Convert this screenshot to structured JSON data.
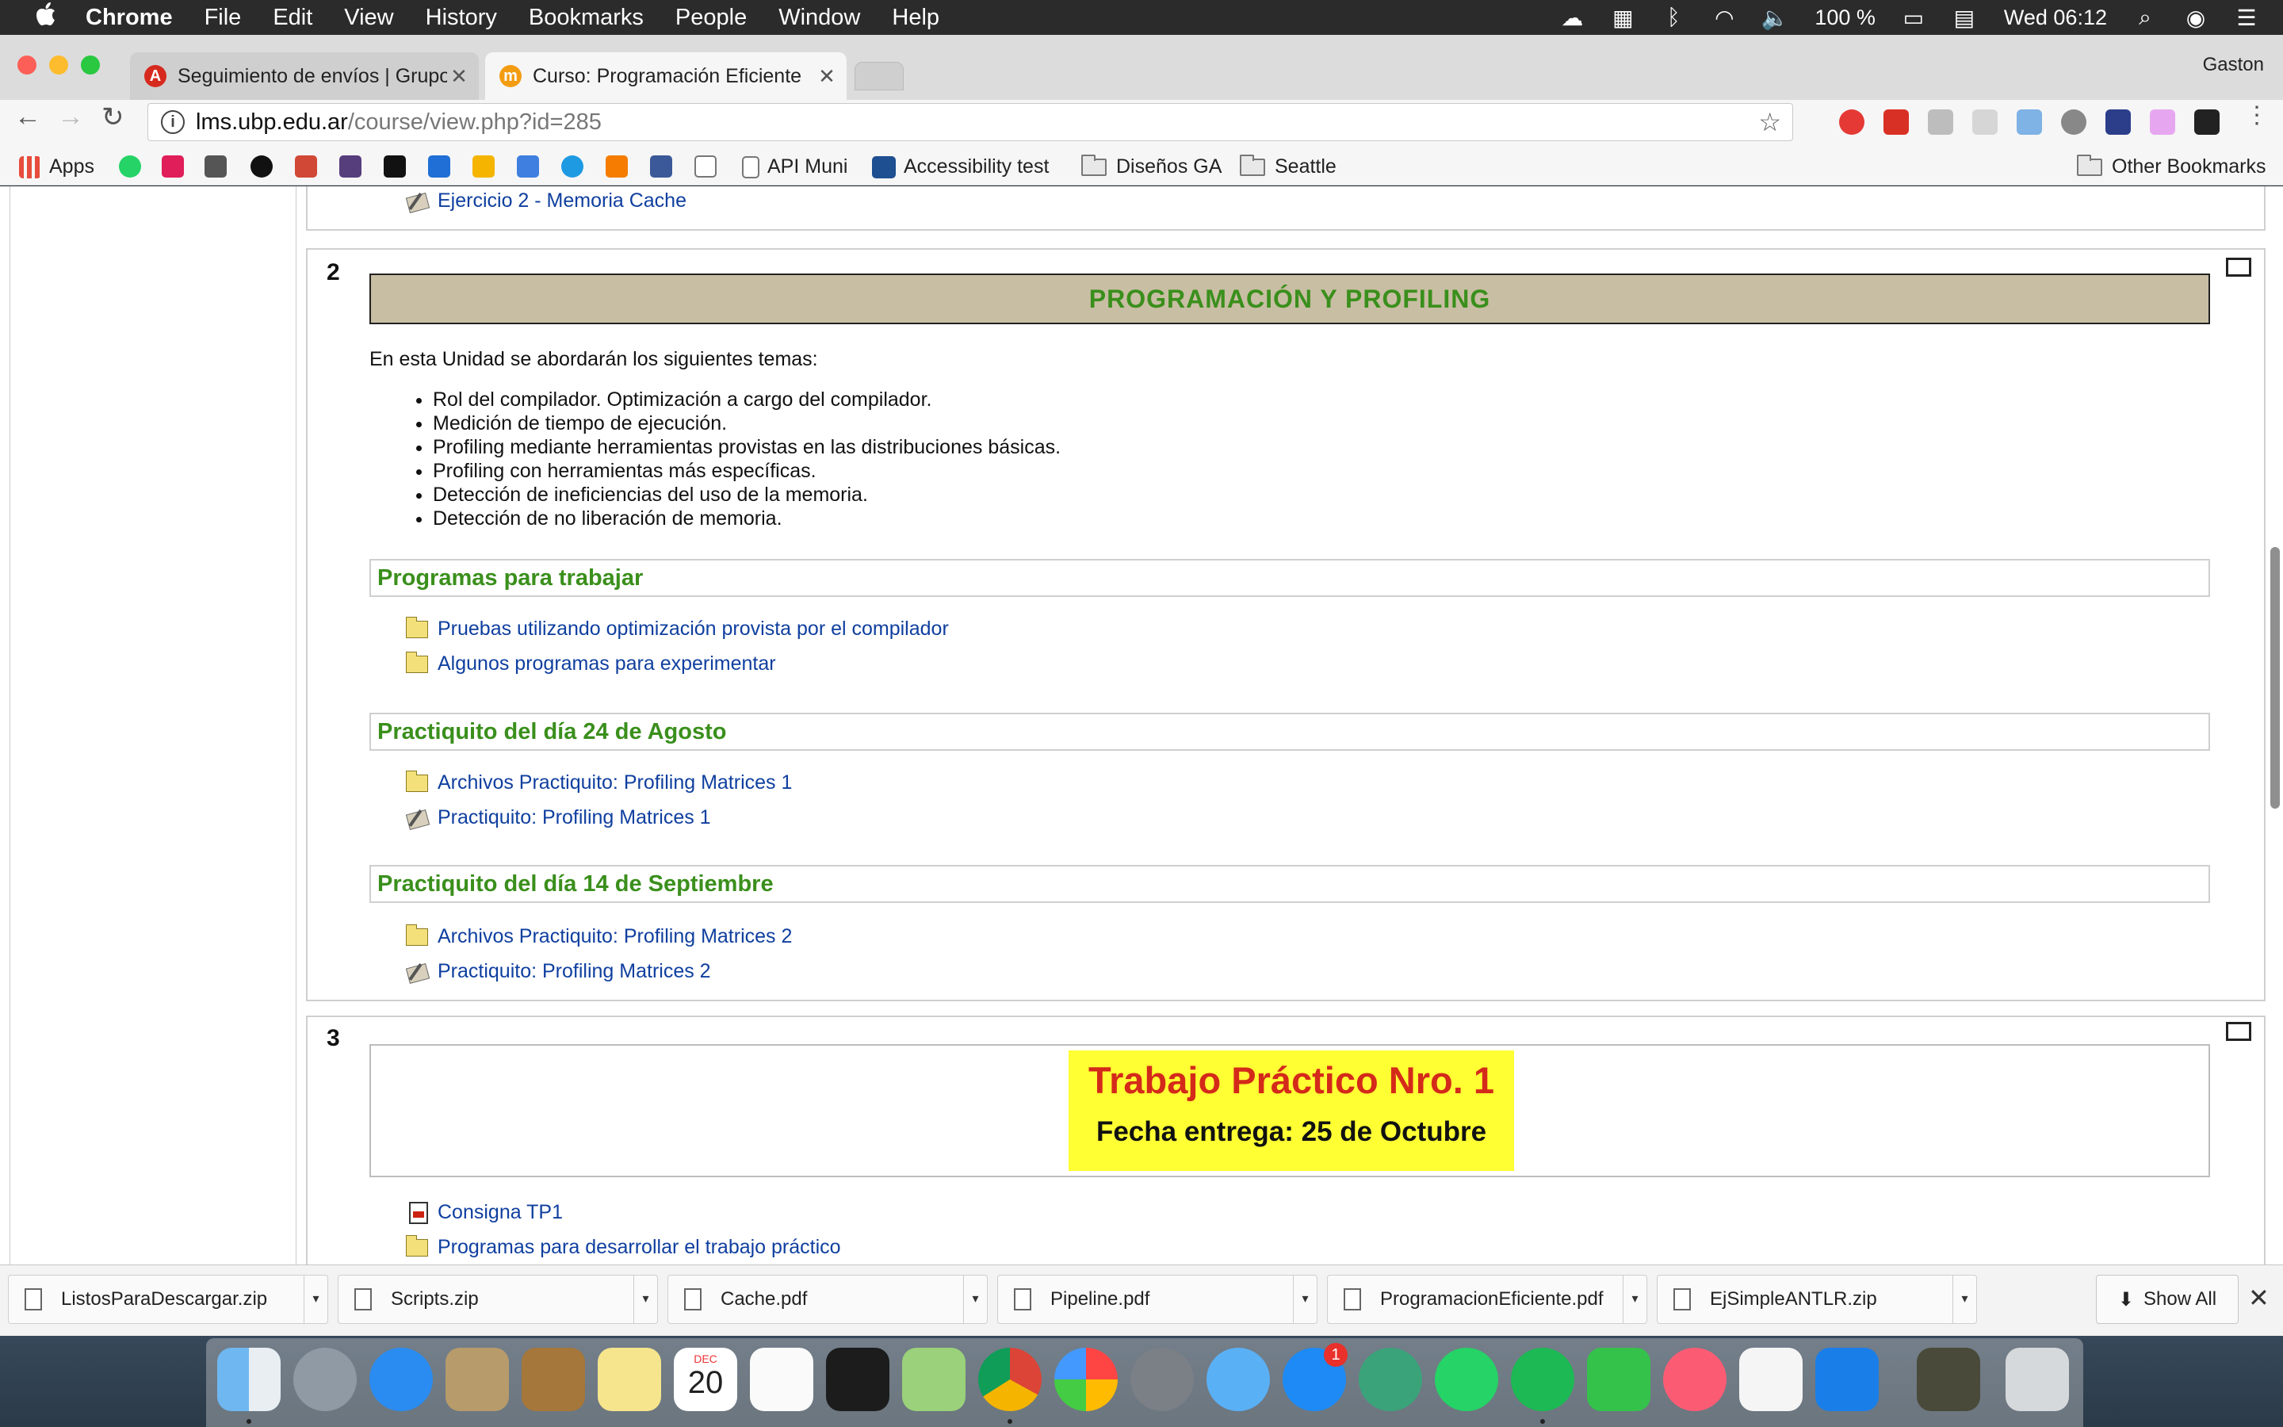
{
  "menubar": {
    "apple": "",
    "app": "Chrome",
    "items": [
      "File",
      "Edit",
      "View",
      "History",
      "Bookmarks",
      "People",
      "Window",
      "Help"
    ],
    "battery": "100 %",
    "clock": "Wed 06:12"
  },
  "tabs": [
    {
      "title": "Seguimiento de envíos | Grupo",
      "icon_color": "#d72a1f",
      "active": false
    },
    {
      "title": "Curso: Programación Eficiente",
      "icon_color": "#f39c12",
      "active": true
    }
  ],
  "profile": "Gaston",
  "omnibox": {
    "host": "lms.ubp.edu.ar",
    "path": "/course/view.php?id=285"
  },
  "bookmarks": {
    "apps": "Apps",
    "items": [
      "API Muni",
      "Accessibility test",
      "Diseños GA",
      "Seattle"
    ],
    "other": "Other Bookmarks"
  },
  "section_prev": {
    "link": "Ejercicio 2 - Memoria Cache"
  },
  "section2": {
    "number": "2",
    "banner": "PROGRAMACIÓN Y PROFILING",
    "intro": "En esta Unidad se abordarán los siguientes temas:",
    "topics": [
      "Rol del compilador. Optimización a cargo del compilador.",
      "Medición de tiempo de ejecución.",
      "Profiling mediante herramientas provistas en las distribuciones básicas.",
      "Profiling con herramientas más específicas.",
      "Detección de ineficiencias del uso de la memoria.",
      "Detección de no liberación de memoria."
    ],
    "groups": [
      {
        "heading": "Programas para trabajar",
        "items": [
          "Pruebas utilizando optimización provista por el compilador",
          "Algunos programas para experimentar"
        ]
      },
      {
        "heading": "Practiquito del día 24 de Agosto",
        "items": [
          "Archivos Practiquito: Profiling Matrices 1",
          "Practiquito: Profiling Matrices 1"
        ]
      },
      {
        "heading": "Practiquito del día 14 de Septiembre",
        "items": [
          "Archivos Practiquito: Profiling Matrices 2",
          "Practiquito: Profiling Matrices 2"
        ]
      }
    ]
  },
  "section3": {
    "number": "3",
    "title": "Trabajo Práctico Nro. 1",
    "subtitle": "Fecha entrega: 25 de Octubre",
    "items": [
      "Consigna TP1",
      "Programas para desarrollar el trabajo práctico"
    ]
  },
  "downloads": [
    "ListosParaDescargar.zip",
    "Scripts.zip",
    "Cache.pdf",
    "Pipeline.pdf",
    "ProgramacionEficiente.pdf",
    "EjSimpleANTLR.zip"
  ],
  "show_all": "Show All",
  "dock": {
    "calendar_month": "DEC",
    "calendar_day": "20",
    "appstore_badge": "1"
  }
}
